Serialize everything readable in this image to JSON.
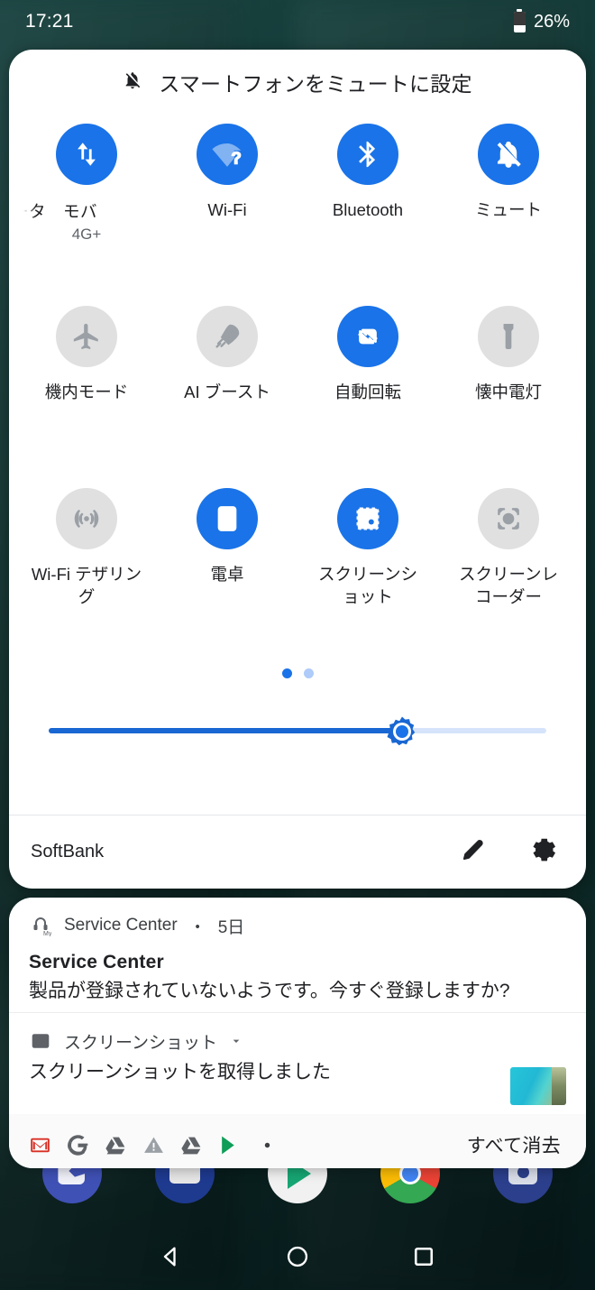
{
  "status_bar": {
    "time": "17:21",
    "battery_percent": "26%"
  },
  "quick_settings": {
    "header_text": "スマートフォンをミュートに設定",
    "header_icon": "bell-off-icon",
    "tiles": [
      {
        "label": "ータ　モバ",
        "sub": "4G+",
        "icon": "mobile-data-icon",
        "active": true
      },
      {
        "label": "Wi-Fi",
        "sub": "",
        "icon": "wifi-question-icon",
        "active": true
      },
      {
        "label": "Bluetooth",
        "sub": "",
        "icon": "bluetooth-icon",
        "active": true
      },
      {
        "label": "ミュート",
        "sub": "",
        "icon": "bell-off-icon",
        "active": true
      },
      {
        "label": "機内モード",
        "sub": "",
        "icon": "airplane-icon",
        "active": false
      },
      {
        "label": "AI ブースト",
        "sub": "",
        "icon": "rocket-icon",
        "active": false
      },
      {
        "label": "自動回転",
        "sub": "",
        "icon": "auto-rotate-icon",
        "active": true
      },
      {
        "label": "懐中電灯",
        "sub": "",
        "icon": "flashlight-icon",
        "active": false
      },
      {
        "label": "Wi-Fi テザリング",
        "sub": "",
        "icon": "hotspot-icon",
        "active": false
      },
      {
        "label": "電卓",
        "sub": "",
        "icon": "calculator-icon",
        "active": true
      },
      {
        "label": "スクリーンショット",
        "sub": "",
        "icon": "screenshot-icon",
        "active": true
      },
      {
        "label": "スクリーンレコーダー",
        "sub": "",
        "icon": "screen-record-icon",
        "active": false
      }
    ],
    "pager": {
      "pages": 2,
      "current": 1
    },
    "brightness": {
      "value_percent": 71,
      "thumb_icon": "brightness-sun-icon"
    },
    "footer": {
      "carrier": "SoftBank",
      "edit_icon": "pencil-icon",
      "settings_icon": "gear-icon"
    }
  },
  "notifications": [
    {
      "app_name": "Service Center",
      "app_icon": "service-center-icon",
      "separator": "・",
      "time": "5日",
      "title": "Service Center",
      "body": "製品が登録されていないようです。今すぐ登録しますか?",
      "has_thumbnail": false
    },
    {
      "app_name": "スクリーンショット",
      "app_icon": "image-icon",
      "expand_icon": "chevron-down-icon",
      "title": "",
      "body": "スクリーンショットを取得しました",
      "has_thumbnail": true
    }
  ],
  "notification_footer": {
    "ongoing_icons": [
      "gmail-icon",
      "google-icon",
      "drive-icon",
      "warning-icon",
      "drive-icon",
      "play-store-icon",
      "more-dot-icon"
    ],
    "clear_all_label": "すべて消去"
  },
  "nav_bar": {
    "back": "back-triangle-icon",
    "home": "home-circle-icon",
    "recents": "recents-square-icon"
  },
  "colors": {
    "accent_blue": "#1a73e8",
    "slider_blue": "#1967d2",
    "track_light": "#d6e4fb",
    "tile_off": "#e0e0e0",
    "text_primary": "#202124"
  }
}
